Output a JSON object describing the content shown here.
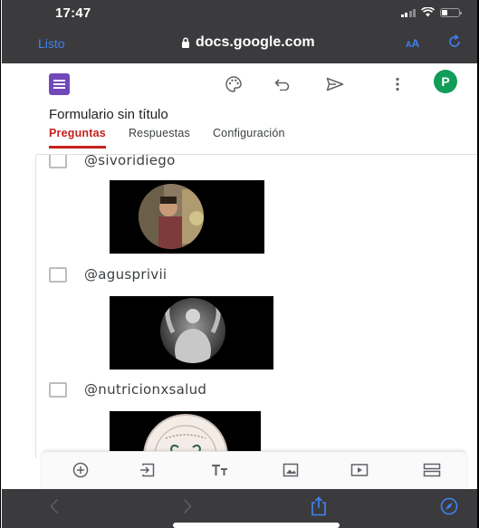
{
  "status": {
    "time": "17:47"
  },
  "browser": {
    "done_label": "Listo",
    "url": "docs.google.com",
    "text_size_label_small": "A",
    "text_size_label_large": "A"
  },
  "form": {
    "avatar_initial": "P",
    "title": "Formulario sin título",
    "tabs": [
      {
        "label": "Preguntas",
        "active": true
      },
      {
        "label": "Respuestas",
        "active": false
      },
      {
        "label": "Configuración",
        "active": false
      }
    ]
  },
  "options": [
    {
      "label": "@sivoridiego"
    },
    {
      "label": "@agusprivii"
    },
    {
      "label": "@nutricionxsalud"
    }
  ],
  "toolbar": {
    "icons": [
      "add-question-icon",
      "import-questions-icon",
      "add-title-icon",
      "add-image-icon",
      "add-video-icon",
      "add-section-icon"
    ]
  },
  "colors": {
    "forms_purple": "#7248b9",
    "accent_red": "#c5221f",
    "safari_blue": "#3f82f6",
    "avatar_green": "#0f9d58"
  }
}
